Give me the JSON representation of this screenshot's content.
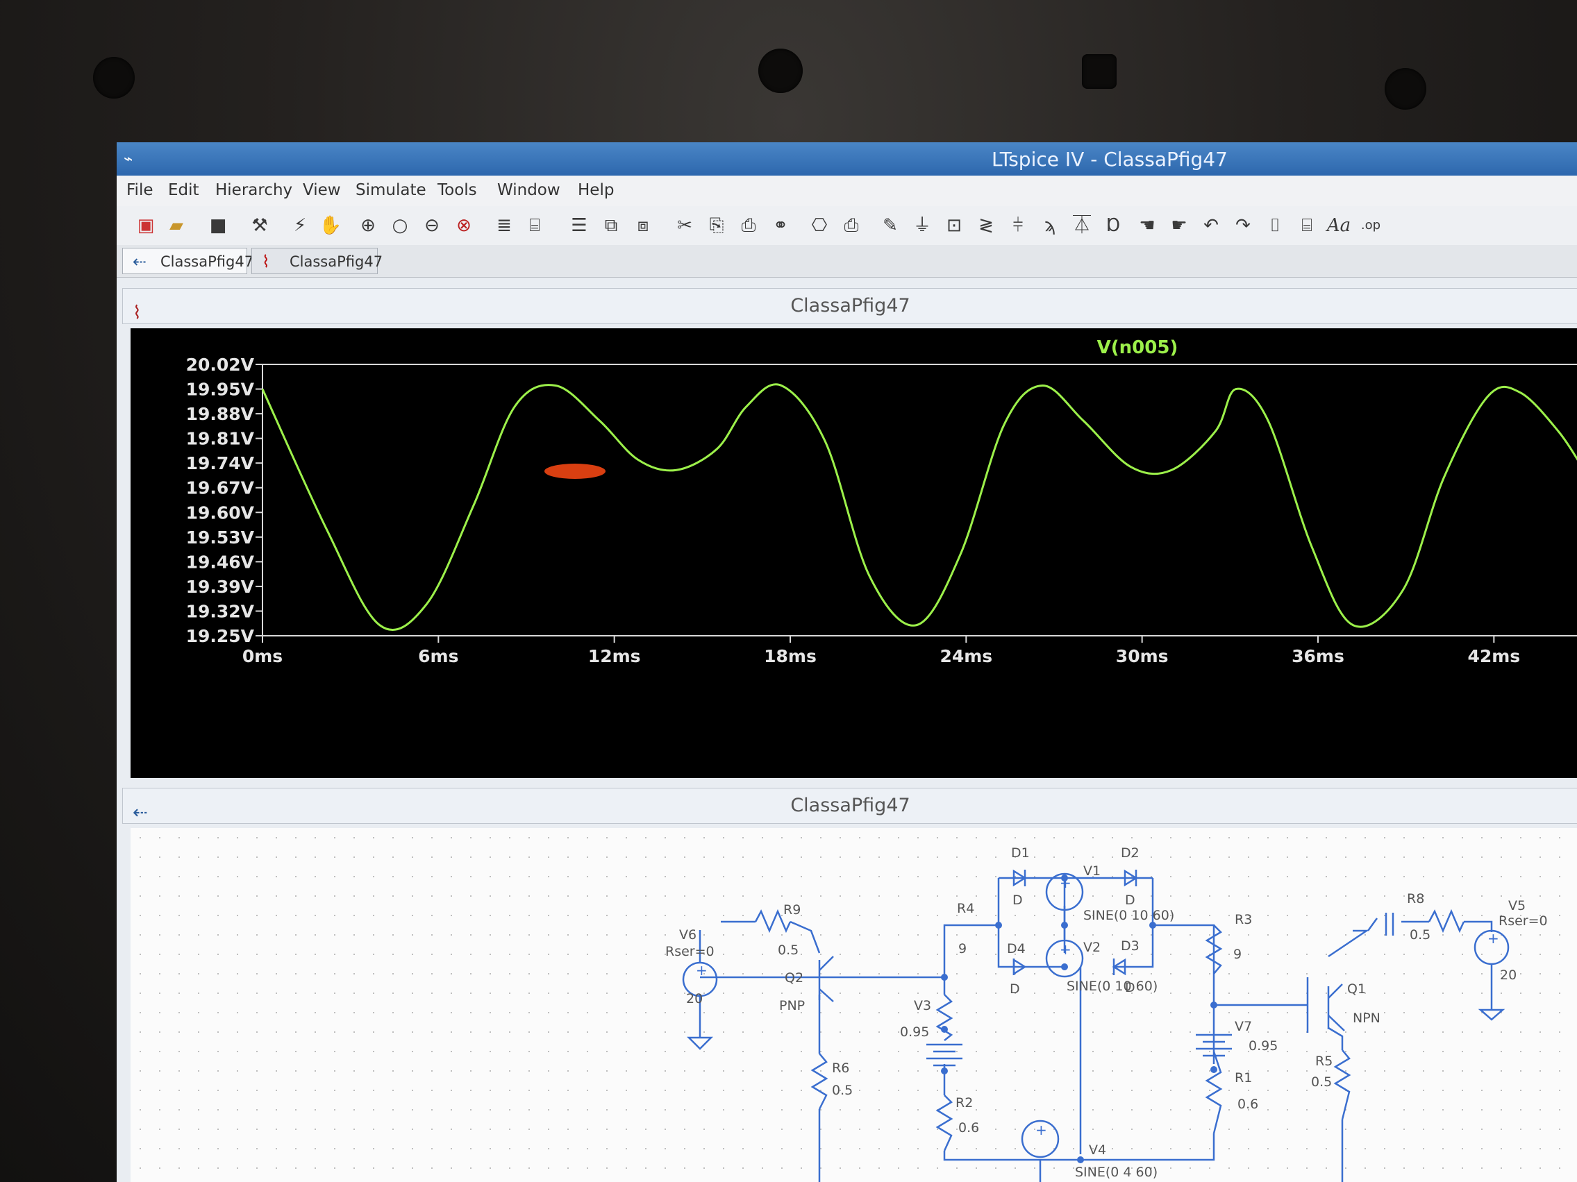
{
  "window": {
    "title": "LTspice IV - ClassaPfig47"
  },
  "menu": [
    "File",
    "Edit",
    "Hierarchy",
    "View",
    "Simulate",
    "Tools",
    "Window",
    "Help"
  ],
  "tabs": [
    {
      "label": "ClassaPfig47",
      "icon": "schematic-icon"
    },
    {
      "label": "ClassaPfig47",
      "icon": "waveform-icon"
    }
  ],
  "waveform_pane": {
    "title": "ClassaPfig47",
    "trace_label": "V(n005)",
    "trace_color": "#9cf04a"
  },
  "chart_data": {
    "type": "line",
    "title": "",
    "series": [
      {
        "name": "V(n005)",
        "x": [
          0,
          2.2,
          4.0,
          5.6,
          7.2,
          8.6,
          10.0,
          11.5,
          12.8,
          14.1,
          15.5,
          16.5,
          17.7,
          19.2,
          20.7,
          22.3,
          23.8,
          25.3,
          26.6,
          28.0,
          29.6,
          31.0,
          32.5,
          33.2,
          34.3,
          35.8,
          37.2,
          38.9,
          40.3,
          41.8,
          42.9,
          44.2,
          45.0
        ],
        "y": [
          19.95,
          19.55,
          19.28,
          19.34,
          19.62,
          19.9,
          19.96,
          19.86,
          19.75,
          19.72,
          19.78,
          19.9,
          19.96,
          19.8,
          19.42,
          19.28,
          19.48,
          19.85,
          19.96,
          19.86,
          19.73,
          19.72,
          19.83,
          19.95,
          19.86,
          19.5,
          19.28,
          19.38,
          19.7,
          19.93,
          19.94,
          19.83,
          19.73
        ]
      }
    ],
    "x_ticks": [
      "0ms",
      "6ms",
      "12ms",
      "18ms",
      "24ms",
      "30ms",
      "36ms",
      "42ms"
    ],
    "x_tick_values": [
      0,
      6,
      12,
      18,
      24,
      30,
      36,
      42
    ],
    "y_ticks": [
      "20.02V",
      "19.95V",
      "19.88V",
      "19.81V",
      "19.74V",
      "19.67V",
      "19.60V",
      "19.53V",
      "19.46V",
      "19.39V",
      "19.32V",
      "19.25V"
    ],
    "y_tick_values": [
      20.02,
      19.95,
      19.88,
      19.81,
      19.74,
      19.67,
      19.6,
      19.53,
      19.46,
      19.39,
      19.32,
      19.25
    ],
    "xlim": [
      0,
      45
    ],
    "ylim": [
      19.25,
      20.02
    ],
    "grid": false
  },
  "schematic_pane": {
    "title": "ClassaPfig47",
    "labels": {
      "d1": "D1",
      "d2": "D2",
      "d3": "D3",
      "d4": "D4",
      "d": "D",
      "v1": "V1",
      "v2": "V2",
      "v3": "V3",
      "v4": "V4",
      "v5": "V5",
      "v6": "V6",
      "v7": "V7",
      "sine1": "SINE(0 10 60)",
      "sine2": "SINE(0 10 60)",
      "sine4": "SINE(0 4 60)",
      "r1": "R1",
      "r2": "R2",
      "r3": "R3",
      "r4": "R4",
      "r5": "R5",
      "r6": "R6",
      "r8": "R8",
      "r9": "R9",
      "val_9": "9",
      "val_05": "0.5",
      "val_06": "0.6",
      "val_095": "0.95",
      "val_20": "20",
      "rser": "Rser=0",
      "q1": "Q1",
      "q2": "Q2",
      "npn": "NPN",
      "pnp": "PNP"
    }
  }
}
